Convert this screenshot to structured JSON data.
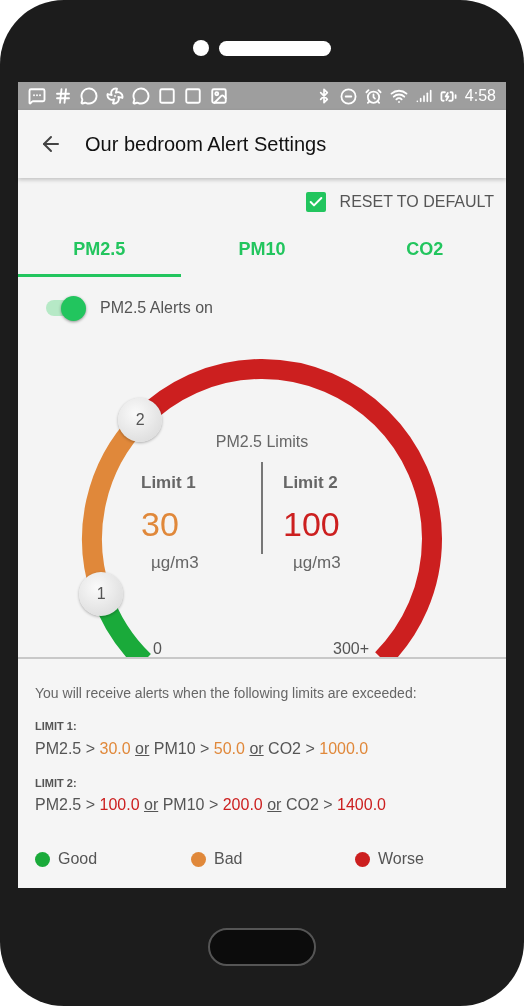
{
  "status_bar": {
    "time": "4:58"
  },
  "app_bar": {
    "title": "Our bedroom Alert Settings"
  },
  "reset": {
    "label": "RESET TO DEFAULT",
    "checked": true
  },
  "tabs": [
    {
      "label": "PM2.5",
      "selected": true
    },
    {
      "label": "PM10",
      "selected": false
    },
    {
      "label": "CO2",
      "selected": false
    }
  ],
  "alerts_toggle": {
    "label": "PM2.5 Alerts on",
    "on": true
  },
  "gauge": {
    "title": "PM2.5 Limits",
    "min_label": "0",
    "max_label": "300+",
    "limits": [
      {
        "label": "Limit 1",
        "value": "30",
        "unit": "µg/m3",
        "handle": "1",
        "color": "#e0883a"
      },
      {
        "label": "Limit 2",
        "value": "100",
        "unit": "µg/m3",
        "handle": "2",
        "color": "#cc1f1f"
      }
    ]
  },
  "info": {
    "intro": "You will receive alerts when the following limits are exceeded:",
    "limits": [
      {
        "label": "LIMIT 1:",
        "parts": [
          {
            "kind": "text",
            "text": "PM2.5 >"
          },
          {
            "kind": "value",
            "text": "30.0"
          },
          {
            "kind": "joiner",
            "text": "or"
          },
          {
            "kind": "text",
            "text": "PM10 >"
          },
          {
            "kind": "value",
            "text": "50.0"
          },
          {
            "kind": "joiner",
            "text": "or"
          },
          {
            "kind": "text",
            "text": "CO2 >"
          },
          {
            "kind": "value",
            "text": "1000.0"
          }
        ]
      },
      {
        "label": "LIMIT 2:",
        "parts": [
          {
            "kind": "text",
            "text": "PM2.5 >"
          },
          {
            "kind": "value",
            "text": "100.0"
          },
          {
            "kind": "joiner",
            "text": "or"
          },
          {
            "kind": "text",
            "text": "PM10 >"
          },
          {
            "kind": "value",
            "text": "200.0"
          },
          {
            "kind": "joiner",
            "text": "or"
          },
          {
            "kind": "text",
            "text": "CO2 >"
          },
          {
            "kind": "value",
            "text": "1400.0"
          }
        ]
      }
    ]
  },
  "legend": [
    {
      "label": "Good",
      "color": "#1aaa3a"
    },
    {
      "label": "Bad",
      "color": "#e0883a"
    },
    {
      "label": "Worse",
      "color": "#cc1f1f"
    }
  ]
}
